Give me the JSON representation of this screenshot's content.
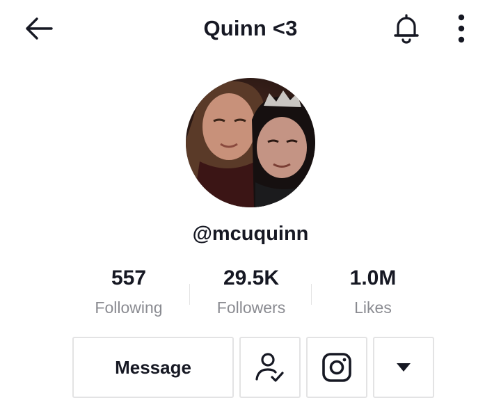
{
  "header": {
    "title": "Quinn <3",
    "back_icon": "arrow-left-icon",
    "bell_icon": "bell-icon",
    "more_icon": "more-vertical-icon"
  },
  "profile": {
    "avatar": "profile-photo",
    "username": "@mcuquinn"
  },
  "stats": [
    {
      "value": "557",
      "label": "Following"
    },
    {
      "value": "29.5K",
      "label": "Followers"
    },
    {
      "value": "1.0M",
      "label": "Likes"
    }
  ],
  "actions": {
    "message_label": "Message",
    "friends_icon": "user-check-icon",
    "instagram_icon": "instagram-icon",
    "dropdown_icon": "caret-down-icon"
  },
  "colors": {
    "text": "#161823",
    "secondary_text": "#8a8b91",
    "border": "#e3e3e4"
  }
}
